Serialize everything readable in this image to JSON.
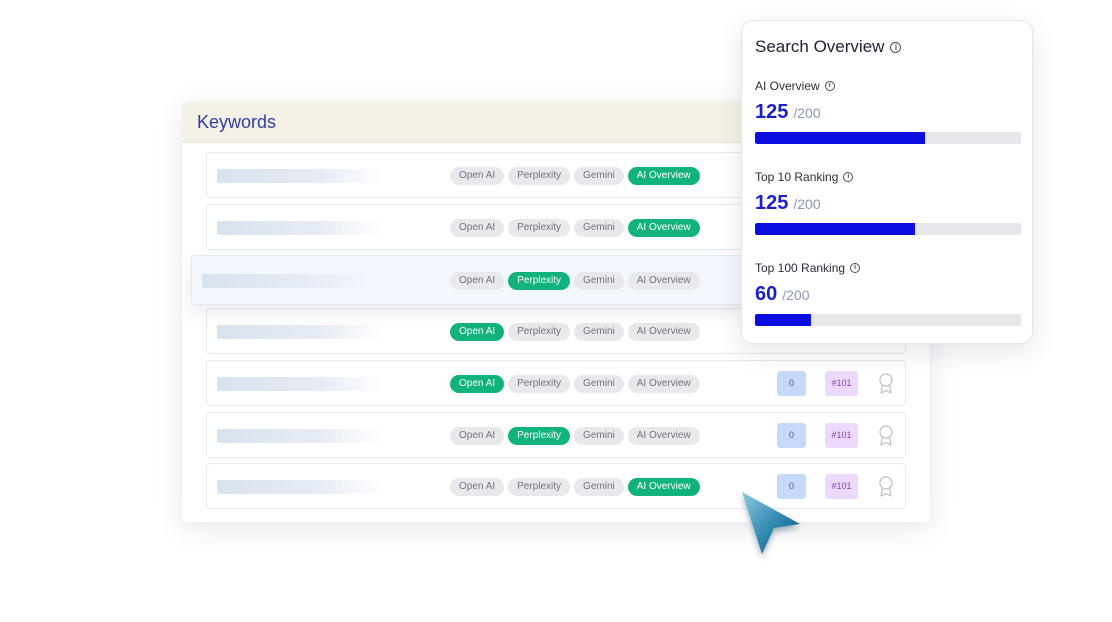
{
  "keywords": {
    "title": "Keywords",
    "rows": [
      {
        "chips": [
          {
            "label": "Open AI",
            "active": false
          },
          {
            "label": "Perplexity",
            "active": false
          },
          {
            "label": "Gemini",
            "active": false
          },
          {
            "label": "AI Overview",
            "active": true
          }
        ]
      },
      {
        "chips": [
          {
            "label": "Open AI",
            "active": false
          },
          {
            "label": "Perplexity",
            "active": false
          },
          {
            "label": "Gemini",
            "active": false
          },
          {
            "label": "AI Overview",
            "active": true
          }
        ]
      },
      {
        "chips": [
          {
            "label": "Open AI",
            "active": false
          },
          {
            "label": "Perplexity",
            "active": true
          },
          {
            "label": "Gemini",
            "active": false
          },
          {
            "label": "AI Overview",
            "active": false
          }
        ]
      },
      {
        "chips": [
          {
            "label": "Open AI",
            "active": true
          },
          {
            "label": "Perplexity",
            "active": false
          },
          {
            "label": "Gemini",
            "active": false
          },
          {
            "label": "AI Overview",
            "active": false
          }
        ]
      },
      {
        "chips": [
          {
            "label": "Open AI",
            "active": true
          },
          {
            "label": "Perplexity",
            "active": false
          },
          {
            "label": "Gemini",
            "active": false
          },
          {
            "label": "AI Overview",
            "active": false
          }
        ],
        "count": "0",
        "rank": "#101"
      },
      {
        "chips": [
          {
            "label": "Open AI",
            "active": false
          },
          {
            "label": "Perplexity",
            "active": true
          },
          {
            "label": "Gemini",
            "active": false
          },
          {
            "label": "AI Overview",
            "active": false
          }
        ],
        "count": "0",
        "rank": "#101"
      },
      {
        "chips": [
          {
            "label": "Open AI",
            "active": false
          },
          {
            "label": "Perplexity",
            "active": false
          },
          {
            "label": "Gemini",
            "active": false
          },
          {
            "label": "AI Overview",
            "active": true
          }
        ],
        "count": "0",
        "rank": "#101"
      }
    ]
  },
  "search_overview": {
    "title": "Search Overview",
    "metrics": [
      {
        "label": "AI Overview",
        "value": "125",
        "max": "/200",
        "fraction": 0.64
      },
      {
        "label": "Top 10 Ranking",
        "value": "125",
        "max": "/200",
        "fraction": 0.6
      },
      {
        "label": "Top 100 Ranking",
        "value": "60",
        "max": "/200",
        "fraction": 0.21
      }
    ]
  },
  "icons": {
    "info": "info-icon",
    "award": "award-ribbon-icon",
    "cursor": "pointer-cursor-icon"
  },
  "colors": {
    "active_chip": "#12b27c",
    "progress_fill": "#0a0ee0",
    "value_text": "#1a1fc9",
    "header_bg": "#f5f1e6"
  }
}
